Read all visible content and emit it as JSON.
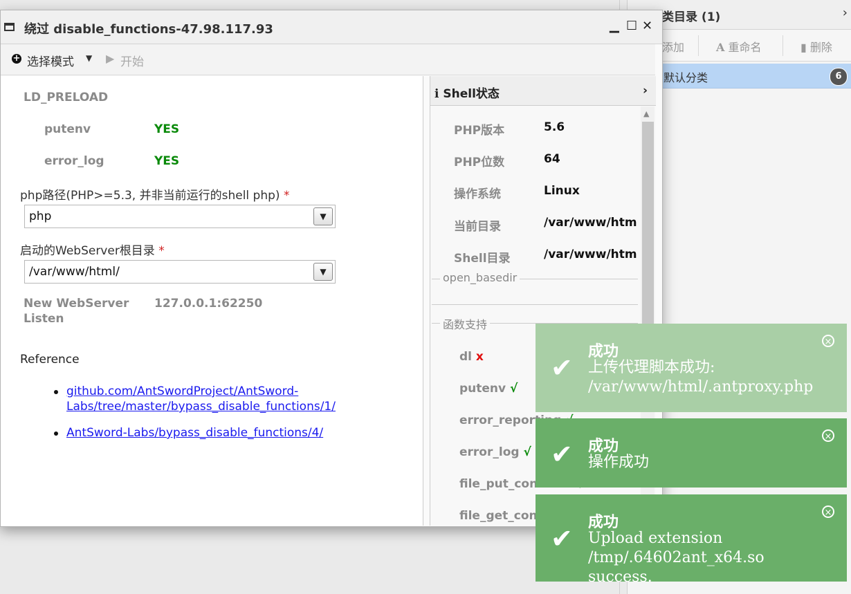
{
  "right_panel": {
    "title": "类目录 (1)",
    "toolbar": {
      "add": "添加",
      "rename": "重命名",
      "delete": "删除"
    },
    "item": {
      "label": "默认分类",
      "count": "6"
    }
  },
  "window": {
    "title": "绕过 disable_functions-47.98.117.93",
    "toolbar": {
      "mode_label": "选择模式",
      "start_label": "开始"
    }
  },
  "form": {
    "ld_preload_label": "LD_PRELOAD",
    "checks": [
      {
        "name": "putenv",
        "status": "YES"
      },
      {
        "name": "error_log",
        "status": "YES"
      }
    ],
    "php_path_label": "php路径(PHP>=5.3, 并非当前运行的shell php)",
    "php_path_value": "php",
    "webroot_label": "启动的WebServer根目录",
    "webroot_value": "/var/www/html/",
    "required_mark": "*",
    "new_webserver_label_1": "New WebServer",
    "new_webserver_label_2": "Listen",
    "new_webserver_value": "127.0.0.1:62250",
    "reference_title": "Reference",
    "references": [
      {
        "line1": "github.com/AntSwordProject/AntSword-",
        "line2": "Labs/tree/master/bypass_disable_functions/1/"
      },
      {
        "line1": "AntSword-Labs/bypass_disable_functions/4/",
        "line2": ""
      }
    ]
  },
  "shell_status": {
    "title": "Shell状态",
    "info": [
      {
        "key": "PHP版本",
        "value": "5.6"
      },
      {
        "key": "PHP位数",
        "value": "64"
      },
      {
        "key": "操作系统",
        "value": "Linux"
      },
      {
        "key": "当前目录",
        "value": "/var/www/htm"
      },
      {
        "key": "Shell目录",
        "value": "/var/www/htm"
      }
    ],
    "open_basedir_label": "open_basedir",
    "functions_label": "函数支持",
    "functions": [
      {
        "name": "dl",
        "mark": "x",
        "ok": false
      },
      {
        "name": "putenv",
        "mark": "√",
        "ok": true
      },
      {
        "name": "error_reporting",
        "mark": "√",
        "ok": true
      },
      {
        "name": "error_log",
        "mark": "√",
        "ok": true
      },
      {
        "name": "file_put_contents",
        "mark": "√",
        "ok": true
      },
      {
        "name": "file_get_contents",
        "mark": "√",
        "ok": true
      }
    ]
  },
  "toasts": [
    {
      "title": "成功",
      "message": "上传代理脚本成功: /var/www/html/.antproxy.php"
    },
    {
      "title": "成功",
      "message": "操作成功"
    },
    {
      "title": "成功",
      "message": "Upload extension /tmp/.64602ant_x64.so success."
    }
  ],
  "colors": {
    "success_toast": "#6aaf69",
    "yes_green": "#0a8a0a",
    "error_red": "#e01010",
    "link_blue": "#1a1aee"
  }
}
